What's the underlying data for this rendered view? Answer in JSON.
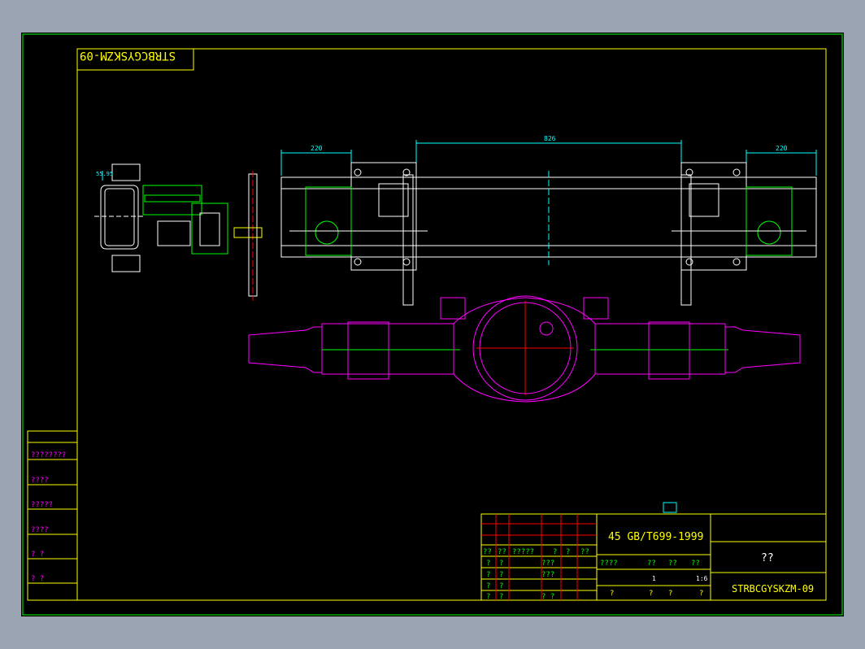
{
  "drawing": {
    "code_stamp": "STRBCGYSKZM-09",
    "dimensions": {
      "left": "220",
      "center": "826",
      "right": "220",
      "side": "55.95"
    }
  },
  "side_table": {
    "rows": [
      "????????",
      "????",
      "?????",
      "????",
      "?   ?",
      "?   ?"
    ]
  },
  "title_block": {
    "material": "45  GB/T699-1999",
    "name": "??",
    "code": "STRBCGYSKZM-09",
    "header_row": [
      "??",
      "??",
      "?????",
      "?",
      "?",
      "??"
    ],
    "rows": [
      {
        "a": "?",
        "b": "?",
        "c": "???"
      },
      {
        "a": "?",
        "b": "?",
        "c": "???"
      },
      {
        "a": "?",
        "b": "?",
        "c": ""
      },
      {
        "a": "?",
        "b": "?",
        "c": "?    ?"
      }
    ],
    "stage_labels": [
      "????",
      "??",
      "??",
      "??"
    ],
    "scale_row": [
      "1",
      "1:6"
    ],
    "sheet_row": [
      "?",
      "?",
      "?",
      "?"
    ]
  }
}
